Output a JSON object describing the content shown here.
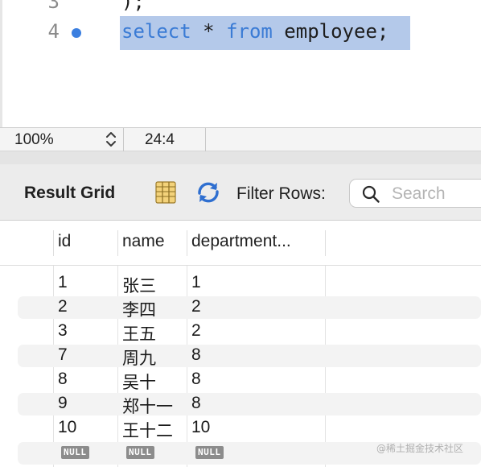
{
  "editor": {
    "lines": [
      {
        "number": "3",
        "text": ");"
      },
      {
        "number": "4",
        "keyword1": "select",
        "op": " * ",
        "keyword2": "from",
        "ident": " employee;"
      }
    ]
  },
  "status_bar": {
    "zoom": "100%",
    "cursor": "24:4"
  },
  "toolbar": {
    "result_grid_label": "Result Grid",
    "filter_label": "Filter Rows:",
    "search_placeholder": "Search",
    "icons": [
      "grid-view-icon",
      "refresh-icon",
      "search-icon"
    ]
  },
  "grid": {
    "columns": [
      "id",
      "name",
      "department..."
    ],
    "rows": [
      {
        "id": "1",
        "name": "张三",
        "department": "1"
      },
      {
        "id": "2",
        "name": "李四",
        "department": "2"
      },
      {
        "id": "3",
        "name": "王五",
        "department": "2"
      },
      {
        "id": "7",
        "name": "周九",
        "department": "8"
      },
      {
        "id": "8",
        "name": "吴十",
        "department": "8"
      },
      {
        "id": "9",
        "name": "郑十一",
        "department": "8"
      },
      {
        "id": "10",
        "name": "王十二",
        "department": "10"
      }
    ],
    "null_row": [
      "NULL",
      "NULL",
      "NULL"
    ]
  },
  "watermark": "@稀土掘金技术社区",
  "colors": {
    "keyword": "#3a7bd5",
    "selection": "#b4c9ea",
    "breakpoint": "#3b7fe0"
  }
}
